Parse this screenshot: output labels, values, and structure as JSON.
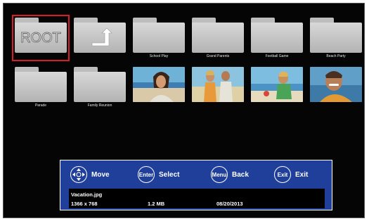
{
  "tiles_row1": [
    {
      "kind": "root",
      "text": "ROOT",
      "label": ""
    },
    {
      "kind": "up",
      "text": "",
      "label": ""
    },
    {
      "kind": "folder",
      "label": "School Play"
    },
    {
      "kind": "folder",
      "label": "Grand Parents"
    },
    {
      "kind": "folder",
      "label": "Football Game"
    },
    {
      "kind": "folder",
      "label": "Beach Party"
    }
  ],
  "tiles_row2": [
    {
      "kind": "folder",
      "label": "Parade"
    },
    {
      "kind": "folder",
      "label": "Family Reunion"
    },
    {
      "kind": "photo",
      "label": ""
    },
    {
      "kind": "photo",
      "label": ""
    },
    {
      "kind": "photo",
      "label": ""
    },
    {
      "kind": "photo",
      "label": ""
    }
  ],
  "help": {
    "move_label": "Move",
    "enter_key": "Enter",
    "select_label": "Select",
    "menu_key": "Menu",
    "back_label": "Back",
    "exit_key": "Exit",
    "exit_label": "Exit"
  },
  "info": {
    "filename": "Vacation.jpg",
    "resolution": "1366 x 768",
    "filesize": "1.2 MB",
    "date": "08/20/2013"
  },
  "colors": {
    "selection": "#d81e2b",
    "panel": "#1f3f9a"
  }
}
